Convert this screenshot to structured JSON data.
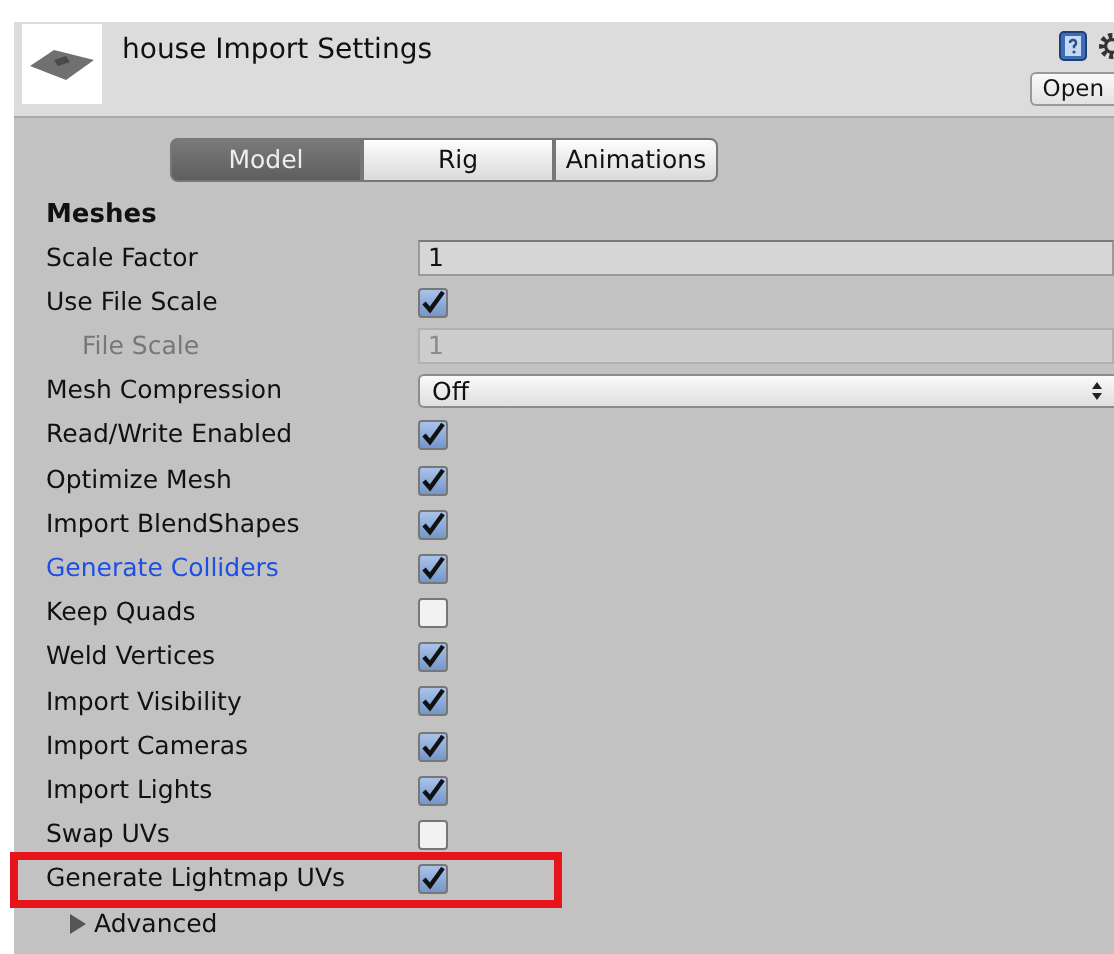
{
  "header": {
    "title": "house Import Settings",
    "open_button": "Open"
  },
  "tabs": [
    {
      "label": "Model",
      "selected": true
    },
    {
      "label": "Rig",
      "selected": false
    },
    {
      "label": "Animations",
      "selected": false
    }
  ],
  "section": "Meshes",
  "rows": [
    {
      "label": "Scale Factor",
      "kind": "field",
      "value": "1",
      "disabled": false,
      "indented": false,
      "modified": false,
      "annotated": false
    },
    {
      "label": "Use File Scale",
      "kind": "checkbox",
      "checked": true,
      "disabled": false,
      "indented": false,
      "modified": false,
      "annotated": false
    },
    {
      "label": "File Scale",
      "kind": "field",
      "value": "1",
      "disabled": true,
      "indented": true,
      "modified": false,
      "annotated": false
    },
    {
      "label": "Mesh Compression",
      "kind": "dropdown",
      "value": "Off",
      "disabled": false,
      "indented": false,
      "modified": false,
      "annotated": false
    },
    {
      "label": "Read/Write Enabled",
      "kind": "checkbox",
      "checked": true,
      "disabled": false,
      "indented": false,
      "modified": false,
      "annotated": false
    },
    {
      "label": "Optimize Mesh",
      "kind": "checkbox",
      "checked": true,
      "disabled": false,
      "indented": false,
      "modified": false,
      "annotated": false
    },
    {
      "label": "Import BlendShapes",
      "kind": "checkbox",
      "checked": true,
      "disabled": false,
      "indented": false,
      "modified": false,
      "annotated": false
    },
    {
      "label": "Generate Colliders",
      "kind": "checkbox",
      "checked": true,
      "disabled": false,
      "indented": false,
      "modified": true,
      "annotated": false
    },
    {
      "label": "Keep Quads",
      "kind": "checkbox",
      "checked": false,
      "disabled": false,
      "indented": false,
      "modified": false,
      "annotated": false
    },
    {
      "label": "Weld Vertices",
      "kind": "checkbox",
      "checked": true,
      "disabled": false,
      "indented": false,
      "modified": false,
      "annotated": false
    },
    {
      "label": "Import Visibility",
      "kind": "checkbox",
      "checked": true,
      "disabled": false,
      "indented": false,
      "modified": false,
      "annotated": false
    },
    {
      "label": "Import Cameras",
      "kind": "checkbox",
      "checked": true,
      "disabled": false,
      "indented": false,
      "modified": false,
      "annotated": false
    },
    {
      "label": "Import Lights",
      "kind": "checkbox",
      "checked": true,
      "disabled": false,
      "indented": false,
      "modified": false,
      "annotated": false
    },
    {
      "label": "Swap UVs",
      "kind": "checkbox",
      "checked": false,
      "disabled": false,
      "indented": false,
      "modified": false,
      "annotated": false
    },
    {
      "label": "Generate Lightmap UVs",
      "kind": "checkbox",
      "checked": true,
      "disabled": false,
      "indented": false,
      "modified": false,
      "annotated": true
    }
  ],
  "advanced": {
    "label": "Advanced",
    "expanded": false
  }
}
